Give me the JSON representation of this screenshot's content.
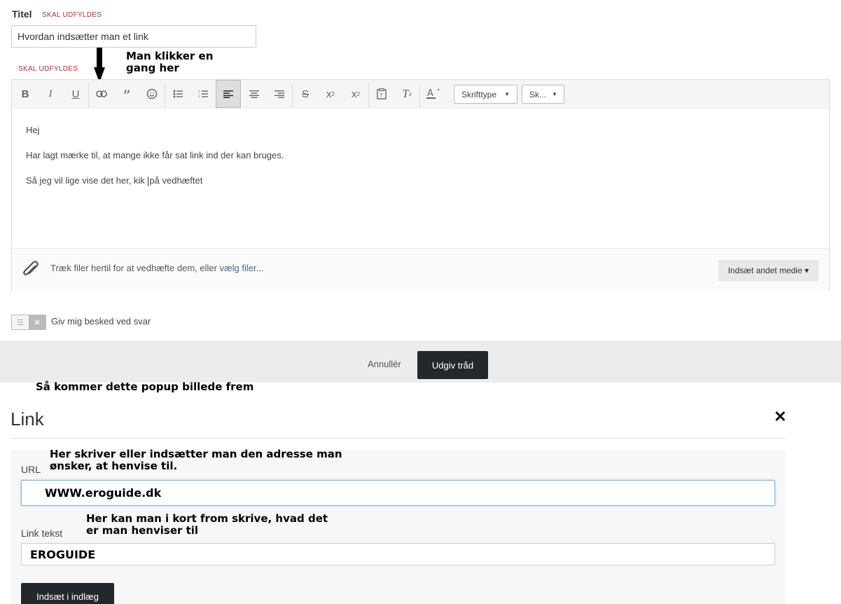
{
  "form": {
    "title_label": "Titel",
    "required_text": "SKAL UDFYLDES",
    "title_value": "Hvordan indsætter man et link"
  },
  "annotations": {
    "click_here": "Man klikker en\ngang her",
    "popup_appears": "Så kommer dette popup billede frem",
    "url_hint": "Her skriver eller indsætter man den adresse man\nønsker, at henvise til.",
    "link_text_hint": "Her kan man i kort from skrive, hvad det\ner man henviser til"
  },
  "toolbar": {
    "font_family": "Skrifttype",
    "font_size": "Sk...",
    "icons": [
      "bold-icon",
      "italic-icon",
      "underline-icon",
      "link-icon",
      "quote-icon",
      "smiley-icon",
      "bullet-list-icon",
      "numbered-list-icon",
      "align-left-icon",
      "align-center-icon",
      "align-right-icon",
      "strikethrough-icon",
      "superscript-icon",
      "subscript-icon",
      "paste-text-icon",
      "clear-format-icon",
      "text-color-icon"
    ]
  },
  "editor": {
    "lines": [
      "Hej",
      "Har lagt mærke til, at mange ikke får sat link ind der kan bruges.",
      "Så jeg vil lige vise det her, kik på vedhæftet"
    ],
    "line3_before_caret": "Så jeg vil lige vise det her, kik ",
    "line3_after_caret": "på vedhæftet"
  },
  "attach": {
    "text": "Træk filer hertil for at vedhæfte dem, eller ",
    "link": "vælg filer...",
    "media_button": "Indsæt andet medie ▾"
  },
  "notify": {
    "label": "Giv mig besked ved svar"
  },
  "footer": {
    "cancel": "Annullér",
    "publish": "Udgiv tråd"
  },
  "popup": {
    "title": "Link",
    "url_label": "URL",
    "url_value": "WWW.eroguide.dk",
    "text_label": "Link tekst",
    "text_value": "EROGUIDE",
    "insert_button": "Indsæt i indlæg"
  }
}
